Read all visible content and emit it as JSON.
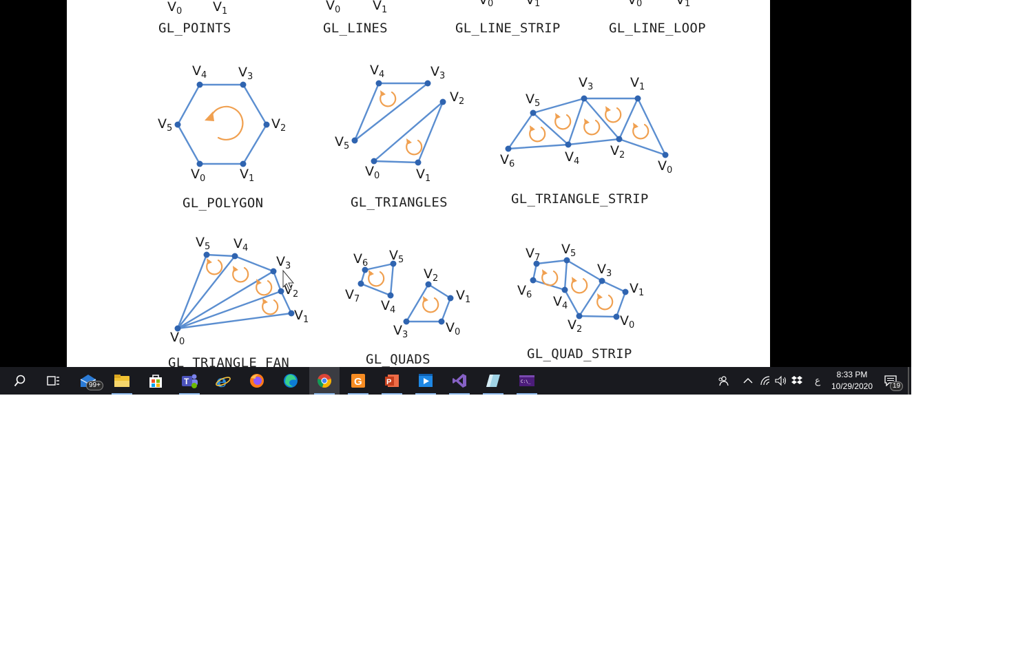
{
  "slide": {
    "captions": {
      "points": "GL_POINTS",
      "lines": "GL_LINES",
      "line_strip": "GL_LINE_STRIP",
      "line_loop": "GL_LINE_LOOP",
      "polygon": "GL_POLYGON",
      "triangles": "GL_TRIANGLES",
      "triangle_strip": "GL_TRIANGLE_STRIP",
      "triangle_fan": "GL_TRIANGLE_FAN",
      "quads": "GL_QUADS",
      "quad_strip": "GL_QUAD_STRIP"
    },
    "vertex_prefix": "V",
    "colors": {
      "edge": "#5b8ed0",
      "vertex": "#2f64b0",
      "winding_arrow": "#f0a050"
    }
  },
  "taskbar": {
    "icons": [
      "search-icon",
      "task-view-icon",
      "mail-icon",
      "file-explorer-icon",
      "store-icon",
      "teams-icon",
      "internet-explorer-icon",
      "firefox-icon",
      "edge-icon",
      "chrome-icon",
      "sublime-icon",
      "powerpoint-icon",
      "movies-icon",
      "visual-studio-icon",
      "app-icon",
      "terminal-icon"
    ],
    "mail_badge": "99+",
    "active_app": "chrome-icon",
    "tray": {
      "icons": [
        "people-icon",
        "chevron-up-icon",
        "network-icon",
        "volume-icon",
        "dropbox-icon"
      ],
      "input_language": "ع",
      "time": "8:33 PM",
      "date": "10/29/2020",
      "notification_count": "19"
    }
  }
}
